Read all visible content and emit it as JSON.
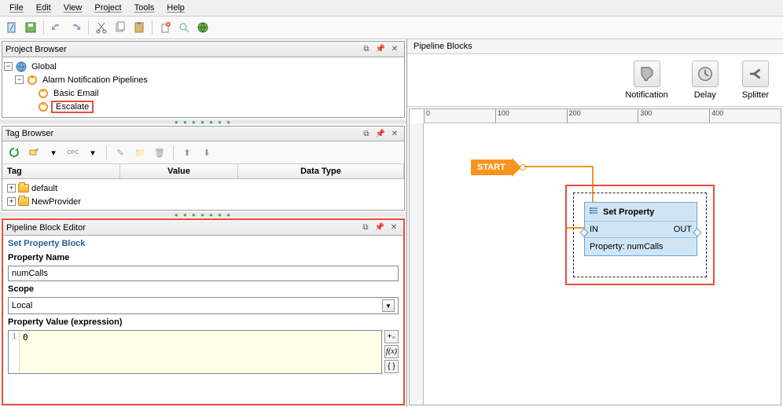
{
  "menubar": [
    "File",
    "Edit",
    "View",
    "Project",
    "Tools",
    "Help"
  ],
  "panels": {
    "project_browser": "Project Browser",
    "tag_browser": "Tag Browser",
    "pipeline_block_editor": "Pipeline Block Editor",
    "pipeline_blocks": "Pipeline Blocks"
  },
  "project_tree": {
    "root": "Global",
    "child1": "Alarm Notification Pipelines",
    "leaf1": "Basic Email",
    "leaf2": "Escalate"
  },
  "tag_table": {
    "col_tag": "Tag",
    "col_value": "Value",
    "col_type": "Data Type",
    "rows": [
      "default",
      "NewProvider"
    ]
  },
  "pbe": {
    "section_title": "Set Property Block",
    "prop_name_label": "Property Name",
    "prop_name_value": "numCalls",
    "scope_label": "Scope",
    "scope_value": "Local",
    "expr_label": "Property Value (expression)",
    "expr_line_num": "1",
    "expr_value": "0"
  },
  "palette": {
    "notification": "Notification",
    "delay": "Delay",
    "splitter": "Splitter"
  },
  "canvas": {
    "start": "START",
    "sp_title": "Set Property",
    "sp_in": "IN",
    "sp_out": "OUT",
    "sp_prop": "Property: numCalls"
  },
  "ruler_ticks": [
    "0",
    "100",
    "200",
    "300",
    "400"
  ],
  "side_btns": [
    "+₌",
    "f(x)",
    "{ }"
  ]
}
